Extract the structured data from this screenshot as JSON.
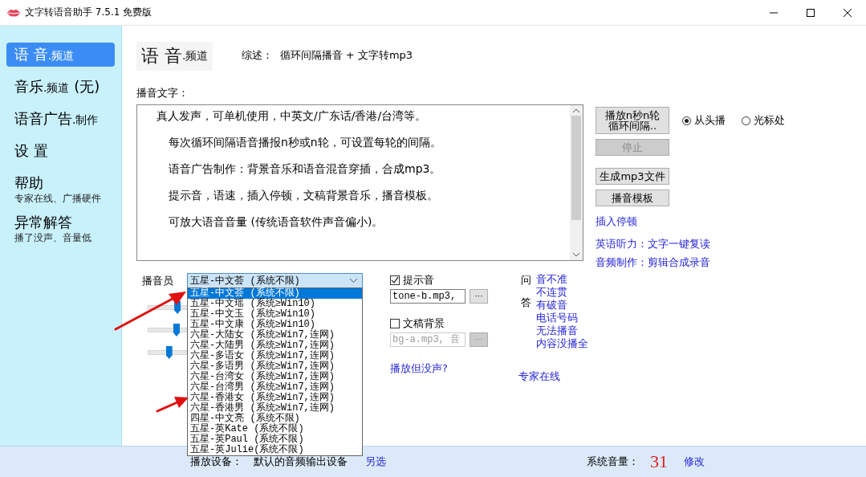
{
  "window": {
    "title": "文字转语音助手 7.5.1 免费版"
  },
  "sidebar": {
    "items": [
      {
        "label": "语 音",
        "suffix": ".频道",
        "selected": true
      },
      {
        "label": "音乐",
        "suffix": ".频道",
        "note": "(无)",
        "selected": false
      },
      {
        "label": "语音广告",
        "suffix": ".制作",
        "selected": false
      },
      {
        "label": "设 置",
        "selected": false
      },
      {
        "label": "帮助",
        "sub": "专家在线、广播硬件",
        "selected": false
      },
      {
        "label": "异常解答",
        "sub": "播了没声、音量低",
        "selected": false
      }
    ]
  },
  "heading": {
    "label": "语 音",
    "suffix": ".频道"
  },
  "summary": {
    "label": "综述：",
    "text": "循环间隔播音 + 文字转mp3"
  },
  "script": {
    "label": "播音文字：",
    "paragraphs": [
      "真人发声，可单机使用，中英文/广东话/香港/台湾等。",
      "每次循环间隔语音播报n秒或n轮，可设置每轮的间隔。",
      "语音广告制作：背景音乐和语音混音穿插，合成mp3。",
      "提示音，语速，插入停顿，文稿背景音乐，播音模板。",
      "可放大语音音量 (传统语音软件声音偏小)。"
    ]
  },
  "buttons": [
    {
      "lines": [
        "播放n秒n轮",
        "循环间隔.."
      ],
      "disabled": false
    },
    {
      "lines": [
        "停止"
      ],
      "disabled": true
    },
    {
      "lines": [
        "生成mp3文件"
      ],
      "disabled": false
    },
    {
      "lines": [
        "播音模板"
      ],
      "disabled": false
    }
  ],
  "start_options": [
    {
      "label": "从头播",
      "selected": true
    },
    {
      "label": "光标处",
      "selected": false
    }
  ],
  "links": [
    "插入停顿",
    "英语听力：文字一键复读",
    "音频制作：剪辑合成录音"
  ],
  "announcer": {
    "label": "播音员",
    "value": "五星-中文荟 (系统不限)",
    "options": [
      {
        "label": "五星-中文荟 (系统不限)",
        "selected": true
      },
      {
        "label": "五星-中文瑶 (系统≥Win10)",
        "selected": false
      },
      {
        "label": "五星-中文玉 (系统≥Win10)",
        "selected": false
      },
      {
        "label": "五星-中文康 (系统≥Win10)",
        "selected": false
      },
      {
        "label": "六星-大陆女 (系统≥Win7,连网)",
        "selected": false
      },
      {
        "label": "六星-大陆男 (系统≥Win7,连网)",
        "selected": false
      },
      {
        "label": "六星-多语女 (系统≥Win7,连网)",
        "selected": false
      },
      {
        "label": "六星-多语男 (系统≥Win7,连网)",
        "selected": false
      },
      {
        "label": "六星-台湾女 (系统≥Win7,连网)",
        "selected": false
      },
      {
        "label": "六星-台湾男 (系统≥Win7,连网)",
        "selected": false
      },
      {
        "label": "六星-香港女 (系统≥Win7,连网)",
        "selected": false
      },
      {
        "label": "六星-香港男 (系统≥Win7,连网)",
        "selected": false
      },
      {
        "label": "四星-中文亮 (系统不限)",
        "selected": false
      },
      {
        "label": "五星-英Kate (系统不限)",
        "selected": false
      },
      {
        "label": "五星-英Paul (系统不限)",
        "selected": false
      },
      {
        "label": "五星-英Julie(系统不限)",
        "selected": false
      }
    ]
  },
  "sliders": [
    {
      "level": 0.32
    },
    {
      "level": 0.31
    },
    {
      "level": 0.23
    }
  ],
  "sound_options": [
    {
      "label": "提示音",
      "checked": true,
      "value": "tone-b.mp3,",
      "browse": "···"
    },
    {
      "label": "文稿背景",
      "checked": false,
      "value": "bg-a.mp3, 音",
      "browse": "···"
    }
  ],
  "faq": {
    "label_top": "问",
    "label_bottom": "答",
    "links": [
      "音不准",
      "不连贯",
      "有破音",
      "电话号码",
      "无法播音",
      "内容没播全"
    ]
  },
  "help_links": [
    "播放但没声?",
    "专家在线"
  ],
  "status_bar": {
    "device_label": "播放设备：",
    "device": "默认的音频输出设备",
    "change_device": "另选",
    "volume_label": "系统音量：",
    "volume": "31",
    "change_volume": "修改"
  }
}
